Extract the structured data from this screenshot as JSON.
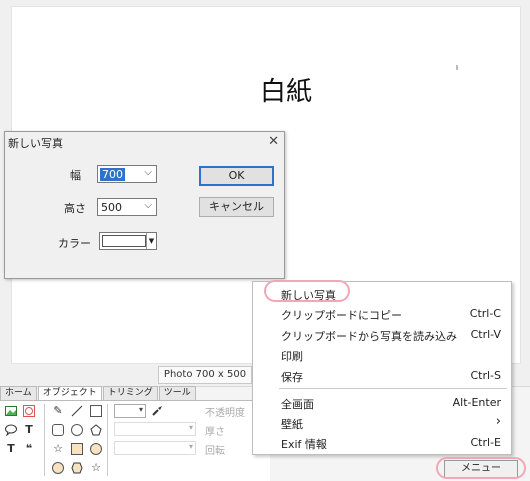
{
  "canvas": {
    "title": "白紙"
  },
  "status": {
    "photo_info": "Photo 700 x 500"
  },
  "ribbon": {
    "tabs": [
      "ホーム",
      "オブジェクト",
      "トリミング",
      "ツール"
    ],
    "labels": {
      "opacity": "不透明度",
      "thickness": "厚さ",
      "rotation": "回転"
    }
  },
  "dialog": {
    "title": "新しい写真",
    "width_label": "幅",
    "width_value": "700",
    "height_label": "高さ",
    "height_value": "500",
    "color_label": "カラー",
    "ok": "OK",
    "cancel": "キャンセル"
  },
  "menu": {
    "items": [
      {
        "label": "新しい写真",
        "shortcut": ""
      },
      {
        "label": "クリップボードにコピー",
        "shortcut": "Ctrl-C"
      },
      {
        "label": "クリップボードから写真を読み込み",
        "shortcut": "Ctrl-V"
      },
      {
        "label": "印刷",
        "shortcut": ""
      },
      {
        "label": "保存",
        "shortcut": "Ctrl-S"
      },
      {
        "label": "全画面",
        "shortcut": "Alt-Enter"
      },
      {
        "label": "壁紙",
        "shortcut": "›"
      },
      {
        "label": "Exif 情報",
        "shortcut": "Ctrl-E"
      }
    ]
  },
  "menu_button": "メニュー",
  "colors": {
    "accent": "#3072c8",
    "highlight": "#f3a6b6"
  }
}
